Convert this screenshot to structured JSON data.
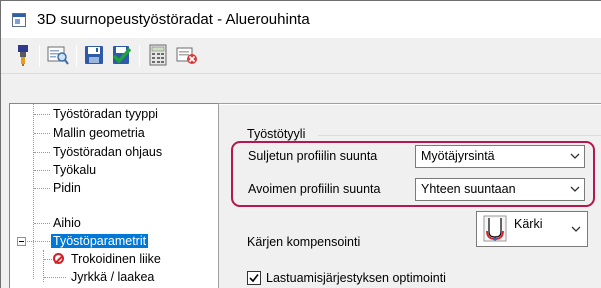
{
  "window": {
    "title": "3D suurnopeustyöstöradat - Aluerouhinta"
  },
  "toolbar": {
    "buttons": [
      {
        "name": "tool-icon"
      },
      {
        "name": "preview-icon"
      },
      {
        "name": "save-icon"
      },
      {
        "name": "save-accept-icon"
      },
      {
        "name": "calculator-icon"
      },
      {
        "name": "delete-icon"
      }
    ]
  },
  "tree": {
    "items": [
      {
        "label": "Työstöradan tyyppi"
      },
      {
        "label": "Mallin geometria"
      },
      {
        "label": "Työstöradan ohjaus"
      },
      {
        "label": "Työkalu"
      },
      {
        "label": "Pidin"
      },
      {
        "label": "Aihio"
      },
      {
        "label": "Työstöparametrit"
      },
      {
        "label": "Trokoidinen liike"
      },
      {
        "label": "Jyrkkä / laakea"
      }
    ]
  },
  "panel": {
    "group_title": "Työstötyyli",
    "closed_profile_label": "Suljetun profiilin suunta",
    "closed_profile_value": "Myötäjyrsintä",
    "open_profile_label": "Avoimen profiilin suunta",
    "open_profile_value": "Yhteen suuntaan",
    "tip_comp_label": "Kärjen kompensointi",
    "tip_comp_value": "Kärki",
    "optimize_label": "Lastuamisjärjestyksen optimointi",
    "optimize_checked": true
  },
  "colors": {
    "selection": "#0078d7",
    "highlight": "#b5174e",
    "forbidden": "#d81f26"
  }
}
